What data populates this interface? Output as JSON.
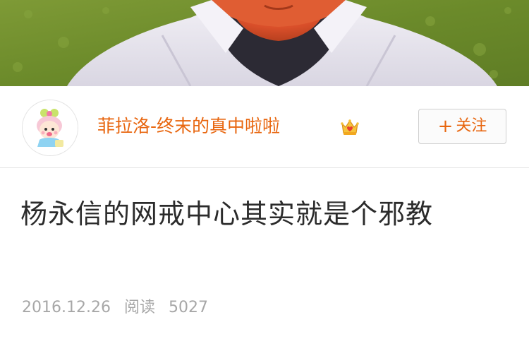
{
  "cover": {
    "image_subject": "person-photo"
  },
  "author": {
    "name": "菲拉洛-终末的真中啦啦",
    "name_color": "#e8660f",
    "badge": "vip-crown-icon",
    "avatar": "cartoon-avatar"
  },
  "follow_button": {
    "icon": "plus-icon",
    "plus": "+",
    "label": "关注",
    "color": "#e8660f"
  },
  "article": {
    "title": "杨永信的网戒中心其实就是个邪教"
  },
  "meta": {
    "date": "2016.12.26",
    "read_label": "阅读",
    "read_count": "5027"
  }
}
